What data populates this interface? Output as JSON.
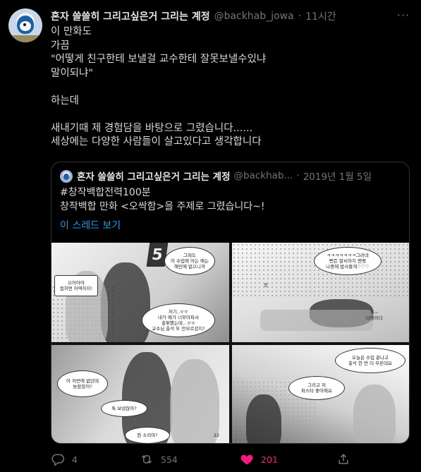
{
  "tweet": {
    "display_name": "혼자 쓸쓸히 그리고싶은거 그리는 계정",
    "handle": "@backhab_jowa",
    "separator": "·",
    "time": "11시간",
    "more_label": "···",
    "text": "이 만화도\n가끔\n\"어떻게 친구한테 보낼걸 교수한테 잘못보낼수있냐\n말이되냐\"\n\n하는데\n\n새내기때 제 경험담을 바탕으로 그렸습니다......\n세상에는 다양한 사람들이 살고있다고 생각합니다"
  },
  "quote": {
    "display_name": "혼자 쓸쓸히 그리고싶은거 그리는 계정",
    "handle": "@backhab...",
    "separator": "·",
    "date": "2019년 1월 5일",
    "text": "#창작백합전력100분\n창작백합 만화 <오싹함>을 주제로 그렸습니다~!",
    "thread_link": "이 스레드 보기"
  },
  "comic": {
    "p1_sign": "5",
    "p1_bubble_top": "그래도\n이 수업에 아는 애는\n해빈에 없으니까",
    "p1_bubble_left": "으아아아\n씹히면 어떡하지!",
    "p1_bubble_right": "저기..ㅠㅠ\n내가 배가 너무아파서\n출튀했는데...ㅠㅠ\n교수님 출석 또 안부르셨지?",
    "p2_bubble_top": "ㅋㅋㅋㅋㅋㅋㅋ그러네\n뻔든 말씨하지 앤뱅\n나중에 밥사줄게♡♡♡",
    "p2_sfx_left": "응",
    "p2_sfx_right": "휴~\n다행이다",
    "p3_bubble_left": "아 저번에 없던데\n늦잠잤어?",
    "p3_bubble_mid": "톡 보냈잖아?",
    "p3_bubble_bottom": "뭔 소리야?",
    "p3_page_number": "22",
    "p4_bubble_top": "오늘은 수업 끝나고\n출석 한 번 더 부른대요",
    "p4_bubble_mid": "그리고 저\n파스타 좋아해요"
  },
  "actions": {
    "reply_count": "4",
    "retweet_count": "554",
    "like_count": "201"
  },
  "colors": {
    "background": "#000000",
    "text": "#d9d9d9",
    "muted": "#6e767d",
    "link": "#1d9bf0",
    "like": "#f91880",
    "border": "#2f3336"
  },
  "icons": [
    "avatar",
    "more-icon",
    "reply-icon",
    "retweet-icon",
    "heart-icon",
    "share-icon"
  ]
}
